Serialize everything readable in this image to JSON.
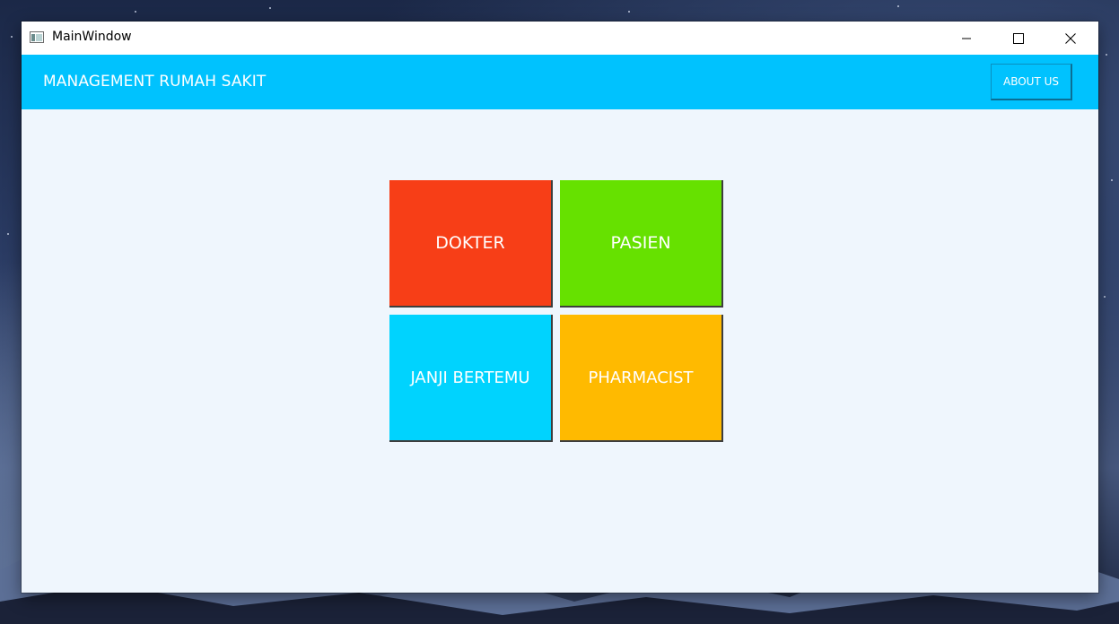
{
  "window": {
    "title": "MainWindow"
  },
  "header": {
    "title": "MANAGEMENT RUMAH SAKIT",
    "about_label": "ABOUT US"
  },
  "tiles": [
    {
      "label": "DOKTER",
      "color": "#f73e17"
    },
    {
      "label": "PASIEN",
      "color": "#66e100"
    },
    {
      "label": "JANJI BERTEMU",
      "color": "#00d3fe"
    },
    {
      "label": "PHARMACIST",
      "color": "#ffba00"
    }
  ],
  "colors": {
    "header_bg": "#00c2fe",
    "content_bg": "#eff6fd"
  }
}
